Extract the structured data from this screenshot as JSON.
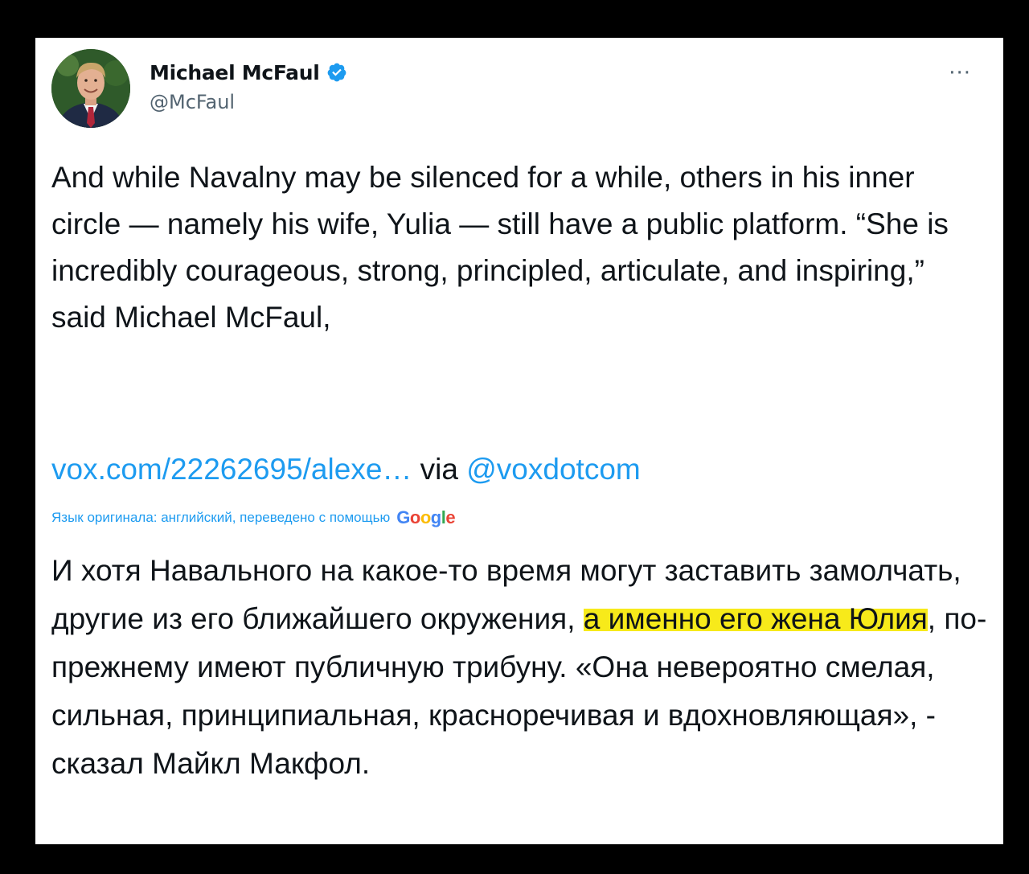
{
  "tweet": {
    "author": {
      "display_name": "Michael McFaul",
      "handle": "@McFaul",
      "verified": true
    },
    "more_icon": "more-horizontal-icon",
    "text_en": "And while Navalny may be silenced for a while, others in his inner circle — namely his wife, Yulia — still have a public platform. “She is incredibly courageous, strong, principled, articulate, and inspiring,” said Michael McFaul,",
    "link": {
      "url_text": "vox.com/22262695/alexe…",
      "via_label": "via",
      "via_handle": "@voxdotcom"
    },
    "translation": {
      "note": "Язык оригинала: английский, переведено с помощью",
      "provider": "Google",
      "text_before": "И хотя Навального на какое-то время могут заставить замолчать, другие из его ближайшего окружения, ",
      "text_highlight": "а именно его жена Юлия",
      "text_after": ", по-прежнему имеют публичную трибуну. «Она невероятно смелая, сильная, принципиальная, красноречивая и вдохновляющая», - сказал Майкл Макфол.",
      "highlight_color": "#f7ea1a"
    },
    "colors": {
      "link": "#1d9bf0",
      "text": "#0f1419",
      "secondary": "#536471",
      "frame": "#000000"
    }
  }
}
